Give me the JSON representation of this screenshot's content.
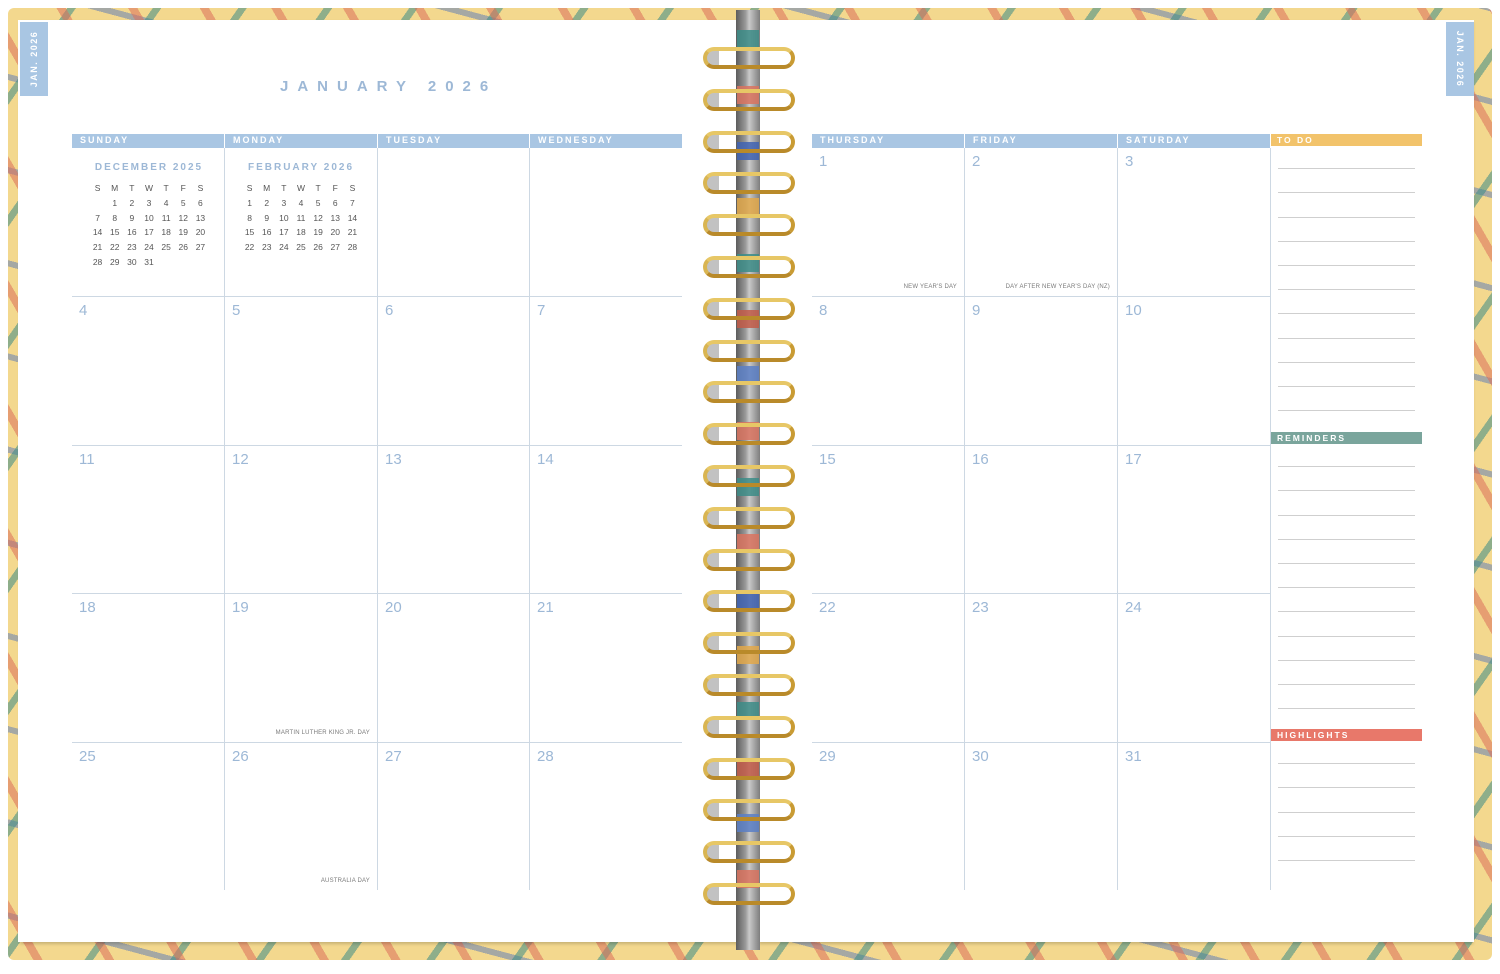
{
  "planner": {
    "month_title": "JANUARY 2026",
    "side_tab_left": "JAN. 2026",
    "side_tab_right": "JAN. 2026"
  },
  "left_page": {
    "days": [
      "SUNDAY",
      "MONDAY",
      "TUESDAY",
      "WEDNESDAY"
    ],
    "mini_calendars": [
      {
        "title": "DECEMBER 2025",
        "weekdays": [
          "S",
          "M",
          "T",
          "W",
          "T",
          "F",
          "S"
        ],
        "weeks": [
          [
            "",
            "1",
            "2",
            "3",
            "4",
            "5",
            "6"
          ],
          [
            "7",
            "8",
            "9",
            "10",
            "11",
            "12",
            "13"
          ],
          [
            "14",
            "15",
            "16",
            "17",
            "18",
            "19",
            "20"
          ],
          [
            "21",
            "22",
            "23",
            "24",
            "25",
            "26",
            "27"
          ],
          [
            "28",
            "29",
            "30",
            "31",
            "",
            "",
            ""
          ]
        ]
      },
      {
        "title": "FEBRUARY 2026",
        "weekdays": [
          "S",
          "M",
          "T",
          "W",
          "T",
          "F",
          "S"
        ],
        "weeks": [
          [
            "1",
            "2",
            "3",
            "4",
            "5",
            "6",
            "7"
          ],
          [
            "8",
            "9",
            "10",
            "11",
            "12",
            "13",
            "14"
          ],
          [
            "15",
            "16",
            "17",
            "18",
            "19",
            "20",
            "21"
          ],
          [
            "22",
            "23",
            "24",
            "25",
            "26",
            "27",
            "28"
          ]
        ]
      }
    ],
    "weeks": [
      [
        {
          "n": ""
        },
        {
          "n": ""
        },
        {
          "n": ""
        },
        {
          "n": ""
        }
      ],
      [
        {
          "n": "4"
        },
        {
          "n": "5"
        },
        {
          "n": "6"
        },
        {
          "n": "7"
        }
      ],
      [
        {
          "n": "11"
        },
        {
          "n": "12"
        },
        {
          "n": "13"
        },
        {
          "n": "14"
        }
      ],
      [
        {
          "n": "18"
        },
        {
          "n": "19",
          "holiday": "MARTIN LUTHER KING JR. DAY"
        },
        {
          "n": "20"
        },
        {
          "n": "21"
        }
      ],
      [
        {
          "n": "25"
        },
        {
          "n": "26",
          "holiday": "AUSTRALIA DAY"
        },
        {
          "n": "27"
        },
        {
          "n": "28"
        }
      ]
    ]
  },
  "right_page": {
    "days": [
      "THURSDAY",
      "FRIDAY",
      "SATURDAY"
    ],
    "weeks": [
      [
        {
          "n": "1",
          "holiday": "NEW YEAR'S DAY"
        },
        {
          "n": "2",
          "holiday": "DAY AFTER NEW YEAR'S DAY (NZ)"
        },
        {
          "n": "3"
        }
      ],
      [
        {
          "n": "8"
        },
        {
          "n": "9"
        },
        {
          "n": "10"
        }
      ],
      [
        {
          "n": "15"
        },
        {
          "n": "16"
        },
        {
          "n": "17"
        }
      ],
      [
        {
          "n": "22"
        },
        {
          "n": "23"
        },
        {
          "n": "24"
        }
      ],
      [
        {
          "n": "29"
        },
        {
          "n": "30"
        },
        {
          "n": "31"
        }
      ]
    ],
    "panels": [
      {
        "label": "TO DO",
        "color": "#f2c36b",
        "lines": 11
      },
      {
        "label": "REMINDERS",
        "color": "#7aa59c",
        "lines": 11
      },
      {
        "label": "HIGHLIGHTS",
        "color": "#e8786a",
        "lines": 5
      }
    ]
  },
  "colors": {
    "header_blue": "#a9c6e3",
    "number_blue": "#9db8d6",
    "ring_gold": "#d4ad4b"
  }
}
